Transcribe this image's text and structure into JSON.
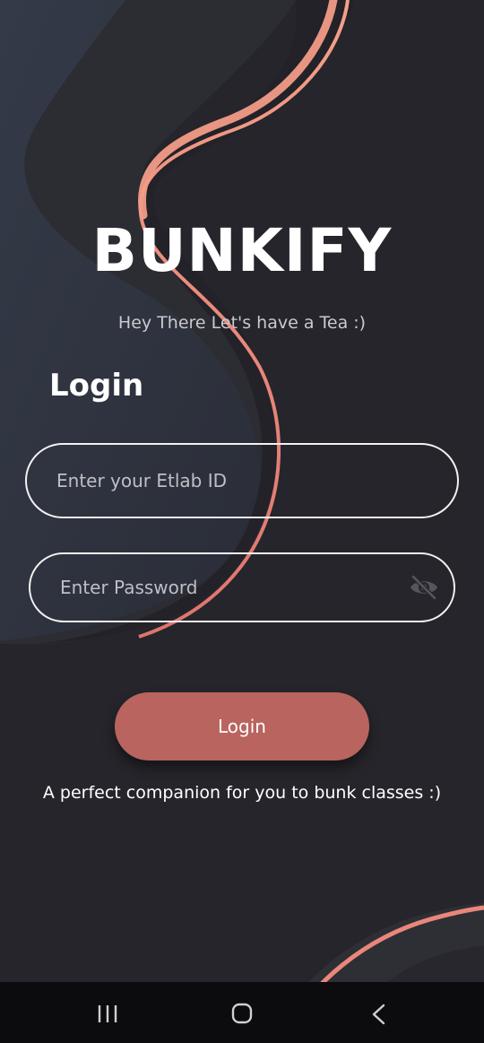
{
  "app": {
    "title": "BUNKIFY",
    "tagline": "Hey There Let's have a Tea :)"
  },
  "login": {
    "heading": "Login",
    "etlab_placeholder": "Enter your Etlab ID",
    "password_placeholder": "Enter Password",
    "button_label": "Login",
    "footer": "A perfect companion for you to bunk classes :)"
  },
  "icons": {
    "password_toggle": "eye-off-icon",
    "nav_recents": "recents-icon",
    "nav_home": "home-icon",
    "nav_back": "back-icon"
  },
  "colors": {
    "background": "#25252b",
    "accent": "#e8877a",
    "button": "#b9645f",
    "text": "#ffffff"
  }
}
